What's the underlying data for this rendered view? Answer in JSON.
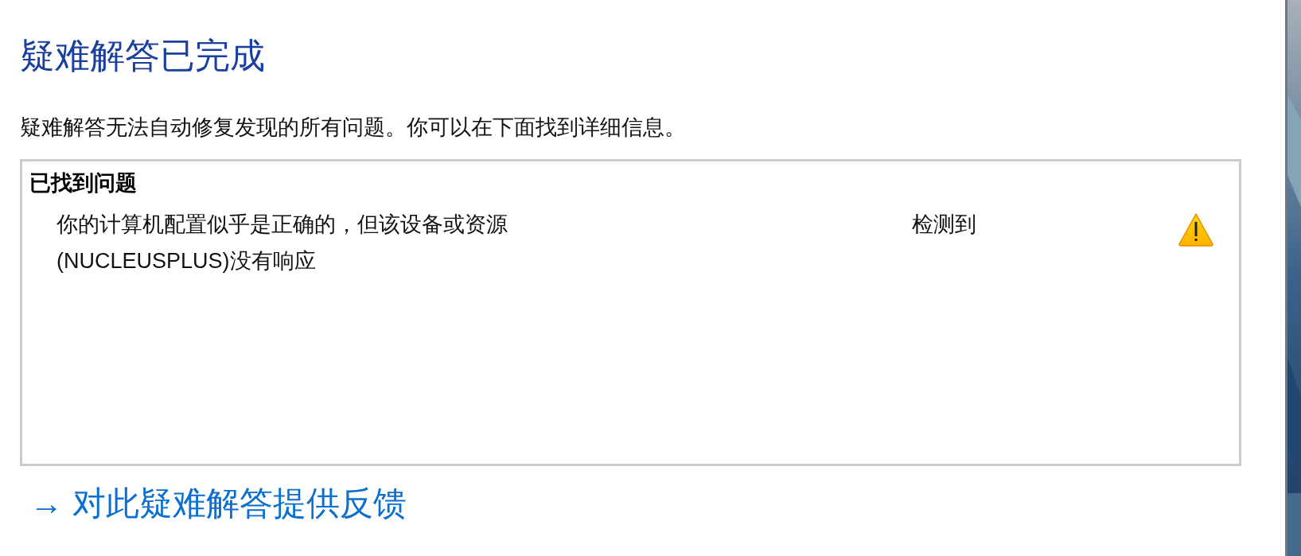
{
  "title": "疑难解答已完成",
  "description": "疑难解答无法自动修复发现的所有问题。你可以在下面找到详细信息。",
  "problems": {
    "heading": "已找到问题",
    "rows": [
      {
        "lines": [
          "你的计算机配置似乎是正确的，但该设备或资源",
          "(NUCLEUSPLUS)没有响应"
        ],
        "status": "检测到",
        "kind": "warning"
      }
    ]
  },
  "feedback_link": {
    "arrow": "→",
    "label": "对此疑难解答提供反馈"
  }
}
